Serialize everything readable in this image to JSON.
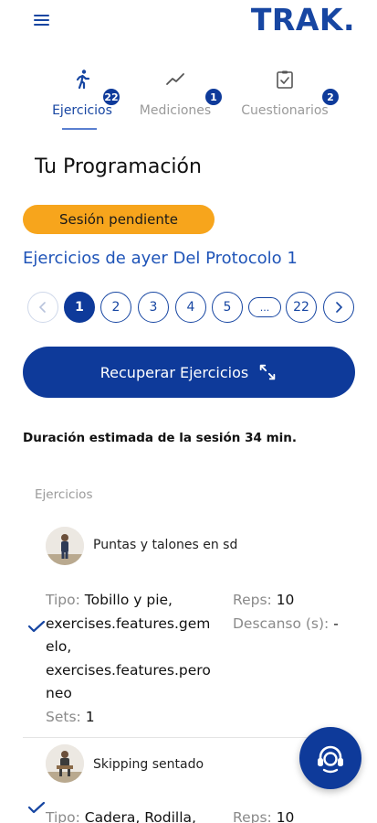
{
  "app": {
    "logo": "TRAK."
  },
  "tabs": [
    {
      "label": "Ejercicios",
      "badge": "22",
      "icon": "running-icon",
      "active": true
    },
    {
      "label": "Mediciones",
      "badge": "1",
      "icon": "trend-line-icon",
      "active": false
    },
    {
      "label": "Cuestionarios",
      "badge": "2",
      "icon": "clipboard-check-icon",
      "active": false
    }
  ],
  "main": {
    "title": "Tu Programación",
    "status": "Sesión pendiente",
    "protocol_title": "Ejercicios de ayer Del Protocolo 1",
    "pagination": {
      "pages": [
        "1",
        "2",
        "3",
        "4",
        "5",
        "...",
        "22"
      ],
      "current": "1"
    },
    "recover_button": "Recuperar Ejercicios",
    "duration": "Duración estimada de la sesión 34 min.",
    "list_heading": "Ejercicios"
  },
  "exercises": [
    {
      "name": "Puntas y talones en sd",
      "type_label": "Tipo:",
      "type_value": "Tobillo y pie, exercises.features.gemelo, exercises.features.peroneo",
      "type_lines": [
        "Tobillo y pie,",
        "exercises.features.gem",
        "elo,",
        "exercises.features.pero",
        "neo"
      ],
      "sets_label": "Sets:",
      "sets_value": "1",
      "reps_label": "Reps:",
      "reps_value": "10",
      "rest_label": "Descanso (s):",
      "rest_value": "-",
      "completed": true
    },
    {
      "name": "Skipping  sentado",
      "type_label": "Tipo:",
      "type_value": "Cadera, Rodilla,",
      "reps_label": "Reps:",
      "reps_value": "10",
      "completed": true
    }
  ],
  "colors": {
    "primary": "#0e3a9a",
    "accent": "#f7a51c",
    "link": "#1f54b8"
  },
  "fab": {
    "icon": "support-agent-icon"
  }
}
